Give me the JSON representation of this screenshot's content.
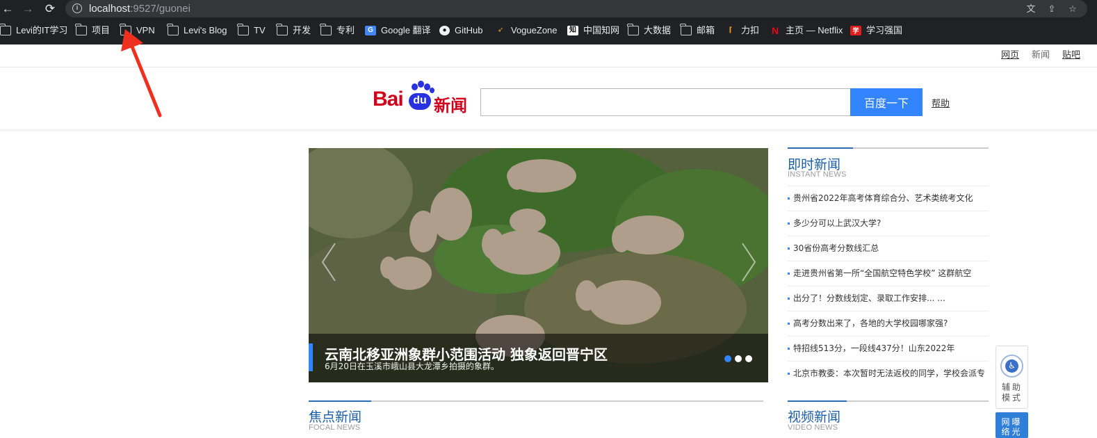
{
  "browser": {
    "url_host": "localhost",
    "url_path": ":9527/guonei",
    "bookmarks": [
      {
        "label": "Levi的IT学习",
        "icon": "folder-icon"
      },
      {
        "label": "项目",
        "icon": "folder-icon"
      },
      {
        "label": "VPN",
        "icon": "folder-icon"
      },
      {
        "label": "Levi's Blog",
        "icon": "folder-icon"
      },
      {
        "label": "TV",
        "icon": "folder-icon"
      },
      {
        "label": "开发",
        "icon": "folder-icon"
      },
      {
        "label": "专利",
        "icon": "folder-icon"
      },
      {
        "label": "Google 翻译",
        "icon": "google-translate-icon"
      },
      {
        "label": "GitHub",
        "icon": "github-icon"
      },
      {
        "label": "VogueZone",
        "icon": "voguezone-icon"
      },
      {
        "label": "中国知网",
        "icon": "cnki-icon"
      },
      {
        "label": "大数据",
        "icon": "folder-icon"
      },
      {
        "label": "邮箱",
        "icon": "folder-icon"
      },
      {
        "label": "力扣",
        "icon": "leetcode-icon"
      },
      {
        "label": "主页 — Netflix",
        "icon": "netflix-icon"
      },
      {
        "label": "学习强国",
        "icon": "xuexi-icon"
      }
    ]
  },
  "topnav": {
    "web": "网页",
    "news": "新闻",
    "tieba": "贴吧"
  },
  "logo": {
    "bai": "Bai",
    "du": "du",
    "xinwen": "新闻"
  },
  "search": {
    "value": "",
    "button": "百度一下",
    "help": "帮助"
  },
  "carousel": {
    "title": "云南北移亚洲象群小范围活动 独象返回晋宁区",
    "subtitle": "6月20日在玉溪市峨山县大龙潭乡拍摄的象群。",
    "active_slide": 1,
    "slide_count": 3
  },
  "instant_news": {
    "title": "即时新闻",
    "subtitle": "INSTANT NEWS",
    "items": [
      "贵州省2022年高考体育综合分、艺术类统考文化",
      "多少分可以上武汉大学?",
      "30省份高考分数线汇总",
      "走进贵州省第一所“全国航空特色学校” 这群航空",
      "出分了！分数线划定、录取工作安排... ...",
      "高考分数出来了，各地的大学校园哪家强?",
      "特招线513分，一段线437分！山东2022年",
      "北京市教委：本次暂时无法返校的同学，学校会派专"
    ]
  },
  "focal_news": {
    "title": "焦点新闻",
    "subtitle": "FOCAL NEWS"
  },
  "video_news": {
    "title": "视频新闻",
    "subtitle": "VIDEO NEWS"
  },
  "assist": {
    "label": "辅助模式",
    "report": "网曝络光"
  }
}
